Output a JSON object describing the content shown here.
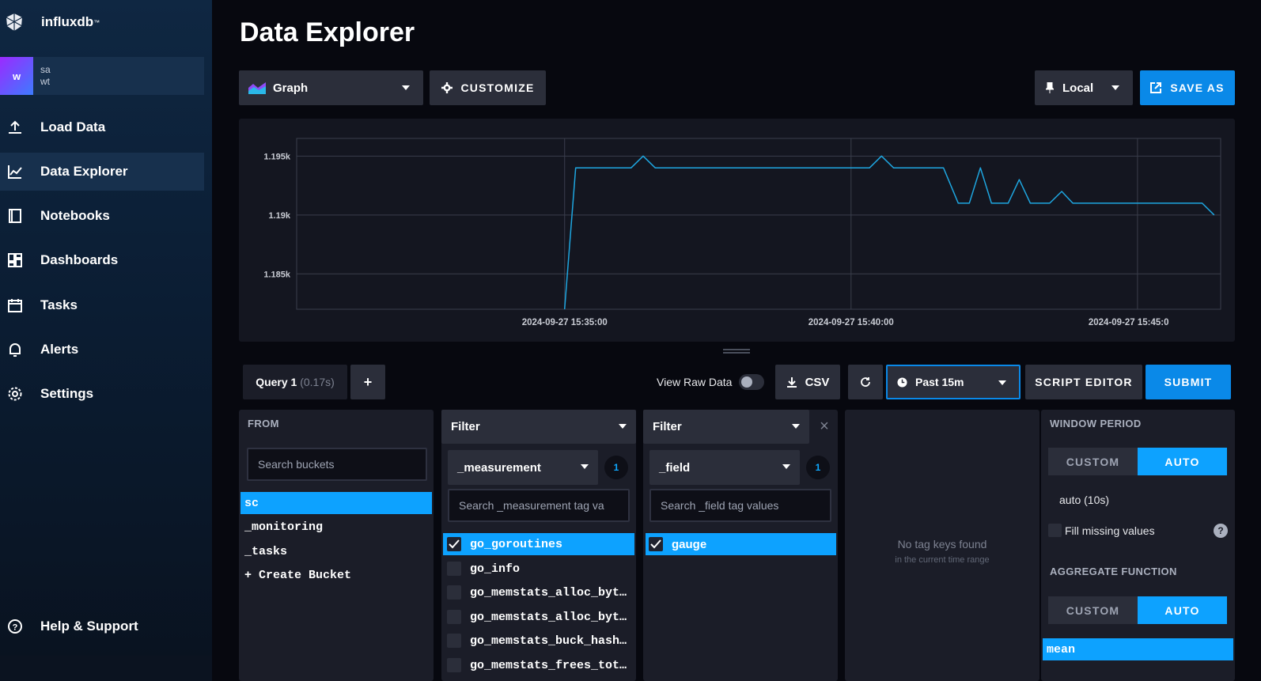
{
  "app": {
    "brand": "influxdb",
    "brand_tm": "™"
  },
  "org": {
    "initial": "w",
    "user": "sa",
    "org": "wt"
  },
  "sidebar": {
    "items": [
      {
        "label": "Load Data",
        "icon": "upload-icon"
      },
      {
        "label": "Data Explorer",
        "icon": "graph-icon"
      },
      {
        "label": "Notebooks",
        "icon": "notebook-icon"
      },
      {
        "label": "Dashboards",
        "icon": "dashboard-icon"
      },
      {
        "label": "Tasks",
        "icon": "calendar-icon"
      },
      {
        "label": "Alerts",
        "icon": "bell-icon"
      },
      {
        "label": "Settings",
        "icon": "gear-icon"
      }
    ],
    "help": "Help & Support"
  },
  "page": {
    "title": "Data Explorer"
  },
  "toolbar": {
    "view_type": "Graph",
    "customize": "CUSTOMIZE",
    "timezone": "Local",
    "save_as": "SAVE AS"
  },
  "chart_data": {
    "type": "line",
    "ylim": [
      1182000,
      1196500
    ],
    "yticks": [
      {
        "v": 1195000,
        "label": "1.195k"
      },
      {
        "v": 1190000,
        "label": "1.19k"
      },
      {
        "v": 1185000,
        "label": "1.185k"
      }
    ],
    "xticks": [
      "2024-09-27 15:35:00",
      "2024-09-27 15:40:00",
      "2024-09-27 15:45:0"
    ],
    "series": [
      {
        "color": "#1ea6e0",
        "points": [
          [
            0.29,
            1182000
          ],
          [
            0.302,
            1194000
          ],
          [
            0.362,
            1194000
          ],
          [
            0.375,
            1195000
          ],
          [
            0.388,
            1194000
          ],
          [
            0.62,
            1194000
          ],
          [
            0.633,
            1195000
          ],
          [
            0.646,
            1194000
          ],
          [
            0.7,
            1194000
          ],
          [
            0.716,
            1191000
          ],
          [
            0.728,
            1191000
          ],
          [
            0.74,
            1194000
          ],
          [
            0.752,
            1191000
          ],
          [
            0.77,
            1191000
          ],
          [
            0.782,
            1193000
          ],
          [
            0.794,
            1191000
          ],
          [
            0.815,
            1191000
          ],
          [
            0.828,
            1192000
          ],
          [
            0.84,
            1191000
          ],
          [
            0.98,
            1191000
          ],
          [
            0.993,
            1190000
          ]
        ]
      }
    ],
    "vlines": [
      0.29,
      0.6,
      0.91
    ]
  },
  "query": {
    "tab": "Query 1",
    "timing": "(0.17s)",
    "add": "+",
    "view_raw": "View Raw Data",
    "csv": "CSV",
    "time_range": "Past 15m",
    "script_editor": "SCRIPT EDITOR",
    "submit": "SUBMIT"
  },
  "from": {
    "header": "FROM",
    "search_placeholder": "Search buckets",
    "buckets": [
      "sc",
      "_monitoring",
      "_tasks",
      "+ Create Bucket"
    ],
    "selected": "sc"
  },
  "filter1": {
    "header": "Filter",
    "key": "_measurement",
    "count": "1",
    "search_placeholder": "Search _measurement tag va",
    "values": [
      "go_goroutines",
      "go_info",
      "go_memstats_alloc_byt…",
      "go_memstats_alloc_byt…",
      "go_memstats_buck_hash…",
      "go_memstats_frees_tot…"
    ],
    "checked": "go_goroutines"
  },
  "filter2": {
    "header": "Filter",
    "key": "_field",
    "count": "1",
    "search_placeholder": "Search _field tag values",
    "values": [
      "gauge"
    ],
    "checked": "gauge"
  },
  "filter3": {
    "empty_title": "No tag keys found",
    "empty_sub": "in the current time range"
  },
  "window": {
    "header": "WINDOW PERIOD",
    "custom": "CUSTOM",
    "auto": "AUTO",
    "auto_value": "auto (10s)",
    "fill_missing": "Fill missing values",
    "help": "?"
  },
  "aggregate": {
    "header": "AGGREGATE FUNCTION",
    "custom": "CUSTOM",
    "auto": "AUTO",
    "functions": [
      "mean"
    ],
    "selected": "mean"
  },
  "colors": {
    "accent": "#0da2ff",
    "button_blue": "#0a89e8",
    "panel": "#1b1d28",
    "line": "#1ea6e0"
  }
}
